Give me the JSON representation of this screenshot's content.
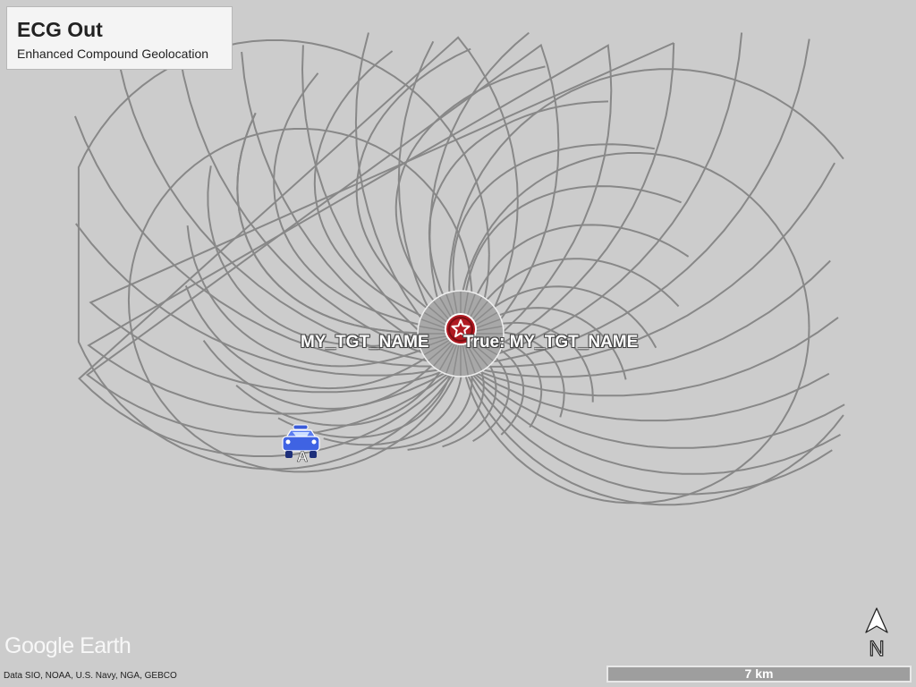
{
  "legend": {
    "title": "ECG Out",
    "subtitle": "Enhanced Compound Geolocation"
  },
  "map": {
    "line_color": "#888888",
    "background_color": "#cccccc",
    "estimate_label": "MY_TGT_NAME",
    "true_label": "True: MY_TGT_NAME",
    "target_icon": "star-in-red-circle-icon",
    "sensor_icon": "car-icon",
    "sensor_label": "A"
  },
  "attribution": {
    "logo": "Google Earth",
    "data_credit": "Data SIO, NOAA, U.S. Navy, NGA, GEBCO"
  },
  "scale": {
    "label": "7 km"
  },
  "compass": {
    "label": "N"
  }
}
